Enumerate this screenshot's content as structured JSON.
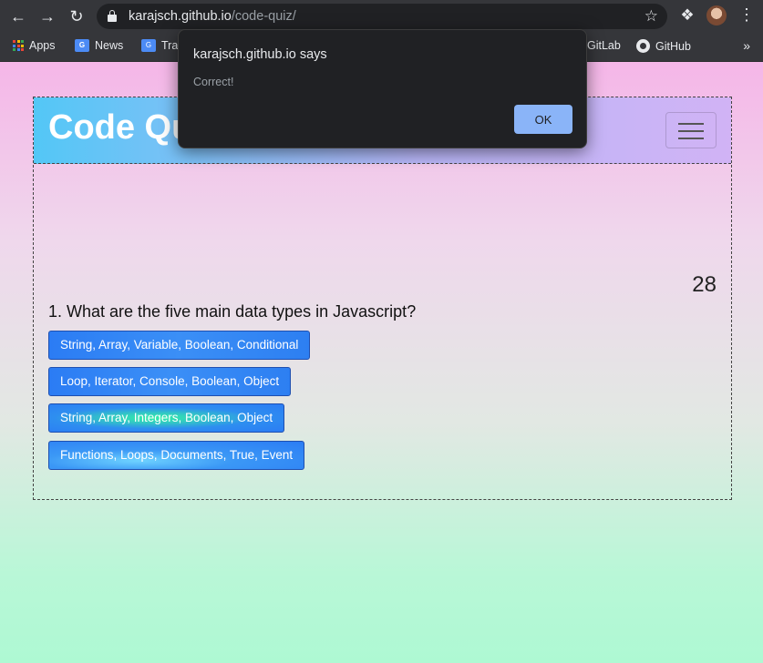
{
  "browser": {
    "url_host": "karajsch.github.io",
    "url_path": "/code-quiz/",
    "icons": {
      "back": "back-arrow-icon",
      "forward": "forward-arrow-icon",
      "reload": "reload-icon",
      "lock": "lock-icon",
      "star": "star-icon",
      "extensions": "puzzle-icon",
      "menu": "vertical-dots-icon"
    }
  },
  "bookmarks": {
    "items": [
      {
        "label": "Apps",
        "icon": "apps-grid-icon"
      },
      {
        "label": "News",
        "icon": "google-news-icon"
      },
      {
        "label": "Tra",
        "icon": "google-translate-icon"
      },
      {
        "label": "GitLab",
        "icon": ""
      },
      {
        "label": "GitHub",
        "icon": "github-icon"
      }
    ],
    "more": "»"
  },
  "dialog": {
    "title": "karajsch.github.io says",
    "message": "Correct!",
    "ok_label": "OK"
  },
  "quiz": {
    "title": "Code Quiz",
    "timer": "28",
    "question": "1. What are the five main data types in Javascript?",
    "answers": [
      "String, Array, Variable, Boolean, Conditional",
      "Loop, Iterator, Console, Boolean, Object",
      "String, Array, Integers, Boolean, Object",
      "Functions, Loops, Documents, True, Event"
    ]
  },
  "colors": {
    "button_blue": "#2b7cf4",
    "header_left": "#53c7f6",
    "header_right": "#d1b3f5",
    "page_top": "#f5b6e8",
    "page_bottom": "#aef9d3",
    "dialog_ok": "#8ab4f8"
  }
}
